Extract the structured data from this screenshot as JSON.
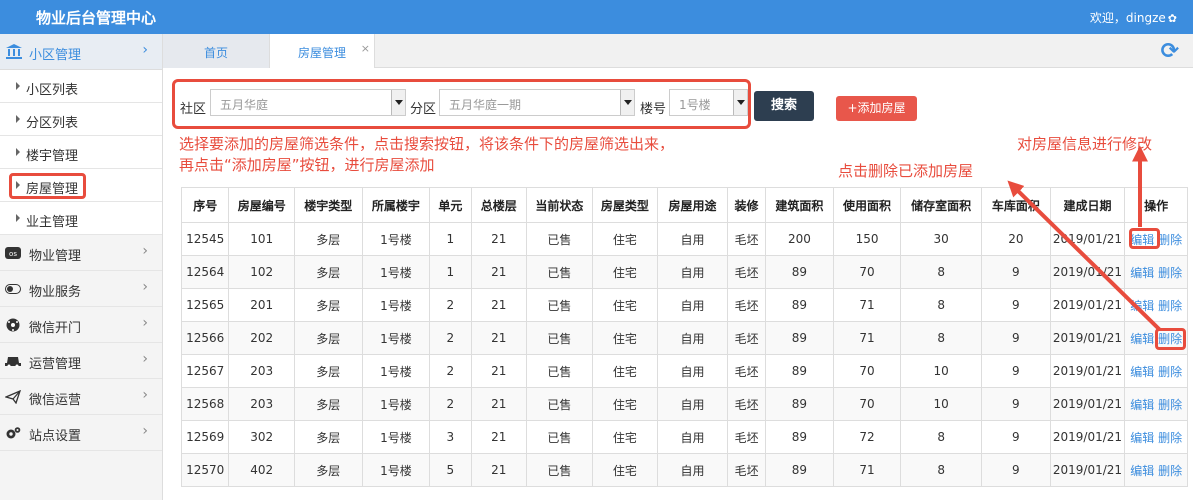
{
  "header": {
    "title": "物业后台管理中心",
    "user_text": "欢迎，dingze",
    "settings_icon": "gear-icon"
  },
  "sidebar": {
    "head": {
      "label": "小区管理",
      "icon": "bank-icon"
    },
    "sub_items": [
      {
        "label": "小区列表"
      },
      {
        "label": "分区列表"
      },
      {
        "label": "楼宇管理"
      },
      {
        "label": "房屋管理"
      },
      {
        "label": "业主管理"
      }
    ],
    "items": [
      {
        "label": "物业管理",
        "icon": "os-badge-icon"
      },
      {
        "label": "物业服务",
        "icon": "toggle-icon"
      },
      {
        "label": "微信开门",
        "icon": "soccer-ball-icon"
      },
      {
        "label": "运营管理",
        "icon": "vehicle-icon"
      },
      {
        "label": "微信运营",
        "icon": "paper-plane-icon"
      },
      {
        "label": "站点设置",
        "icon": "cogs-icon"
      }
    ]
  },
  "tabs": [
    {
      "label": "首页"
    },
    {
      "label": "房屋管理",
      "close": "×"
    }
  ],
  "filters": {
    "community_label": "社区",
    "community_value": "五月华庭",
    "district_label": "分区",
    "district_value": "五月华庭一期",
    "building_label": "楼号",
    "building_value": "1号楼",
    "search_label": "搜索",
    "add_label": "+添加房屋"
  },
  "annotations": {
    "filter_note_line1": "选择要添加的房屋筛选条件，点击搜索按钮，将该条件下的房屋筛选出来，",
    "filter_note_line2": "再点击“添加房屋”按钮，进行房屋添加",
    "edit_note": "对房屋信息进行修改",
    "delete_note": "点击删除已添加房屋",
    "color": "#e84c3d"
  },
  "table": {
    "columns": [
      "序号",
      "房屋编号",
      "楼宇类型",
      "所属楼宇",
      "单元",
      "总楼层",
      "当前状态",
      "房屋类型",
      "房屋用途",
      "装修",
      "建筑面积",
      "使用面积",
      "储存室面积",
      "车库面积",
      "建成日期",
      "操作"
    ],
    "edit_label": "编辑",
    "delete_label": "删除",
    "rows": [
      [
        "12545",
        "101",
        "多层",
        "1号楼",
        "1",
        "21",
        "已售",
        "住宅",
        "自用",
        "毛坯",
        "200",
        "150",
        "30",
        "20",
        "2019/01/21"
      ],
      [
        "12564",
        "102",
        "多层",
        "1号楼",
        "1",
        "21",
        "已售",
        "住宅",
        "自用",
        "毛坯",
        "89",
        "70",
        "8",
        "9",
        "2019/01/21"
      ],
      [
        "12565",
        "201",
        "多层",
        "1号楼",
        "2",
        "21",
        "已售",
        "住宅",
        "自用",
        "毛坯",
        "89",
        "71",
        "8",
        "9",
        "2019/01/21"
      ],
      [
        "12566",
        "202",
        "多层",
        "1号楼",
        "2",
        "21",
        "已售",
        "住宅",
        "自用",
        "毛坯",
        "89",
        "71",
        "8",
        "9",
        "2019/01/21"
      ],
      [
        "12567",
        "203",
        "多层",
        "1号楼",
        "2",
        "21",
        "已售",
        "住宅",
        "自用",
        "毛坯",
        "89",
        "70",
        "10",
        "9",
        "2019/01/21"
      ],
      [
        "12568",
        "203",
        "多层",
        "1号楼",
        "2",
        "21",
        "已售",
        "住宅",
        "自用",
        "毛坯",
        "89",
        "70",
        "10",
        "9",
        "2019/01/21"
      ],
      [
        "12569",
        "302",
        "多层",
        "1号楼",
        "3",
        "21",
        "已售",
        "住宅",
        "自用",
        "毛坯",
        "89",
        "72",
        "8",
        "9",
        "2019/01/21"
      ],
      [
        "12570",
        "402",
        "多层",
        "1号楼",
        "5",
        "21",
        "已售",
        "住宅",
        "自用",
        "毛坯",
        "89",
        "71",
        "8",
        "9",
        "2019/01/21"
      ]
    ]
  },
  "colors": {
    "primary": "#3c8dde",
    "dark": "#2d3e50",
    "danger": "#e8574b"
  }
}
